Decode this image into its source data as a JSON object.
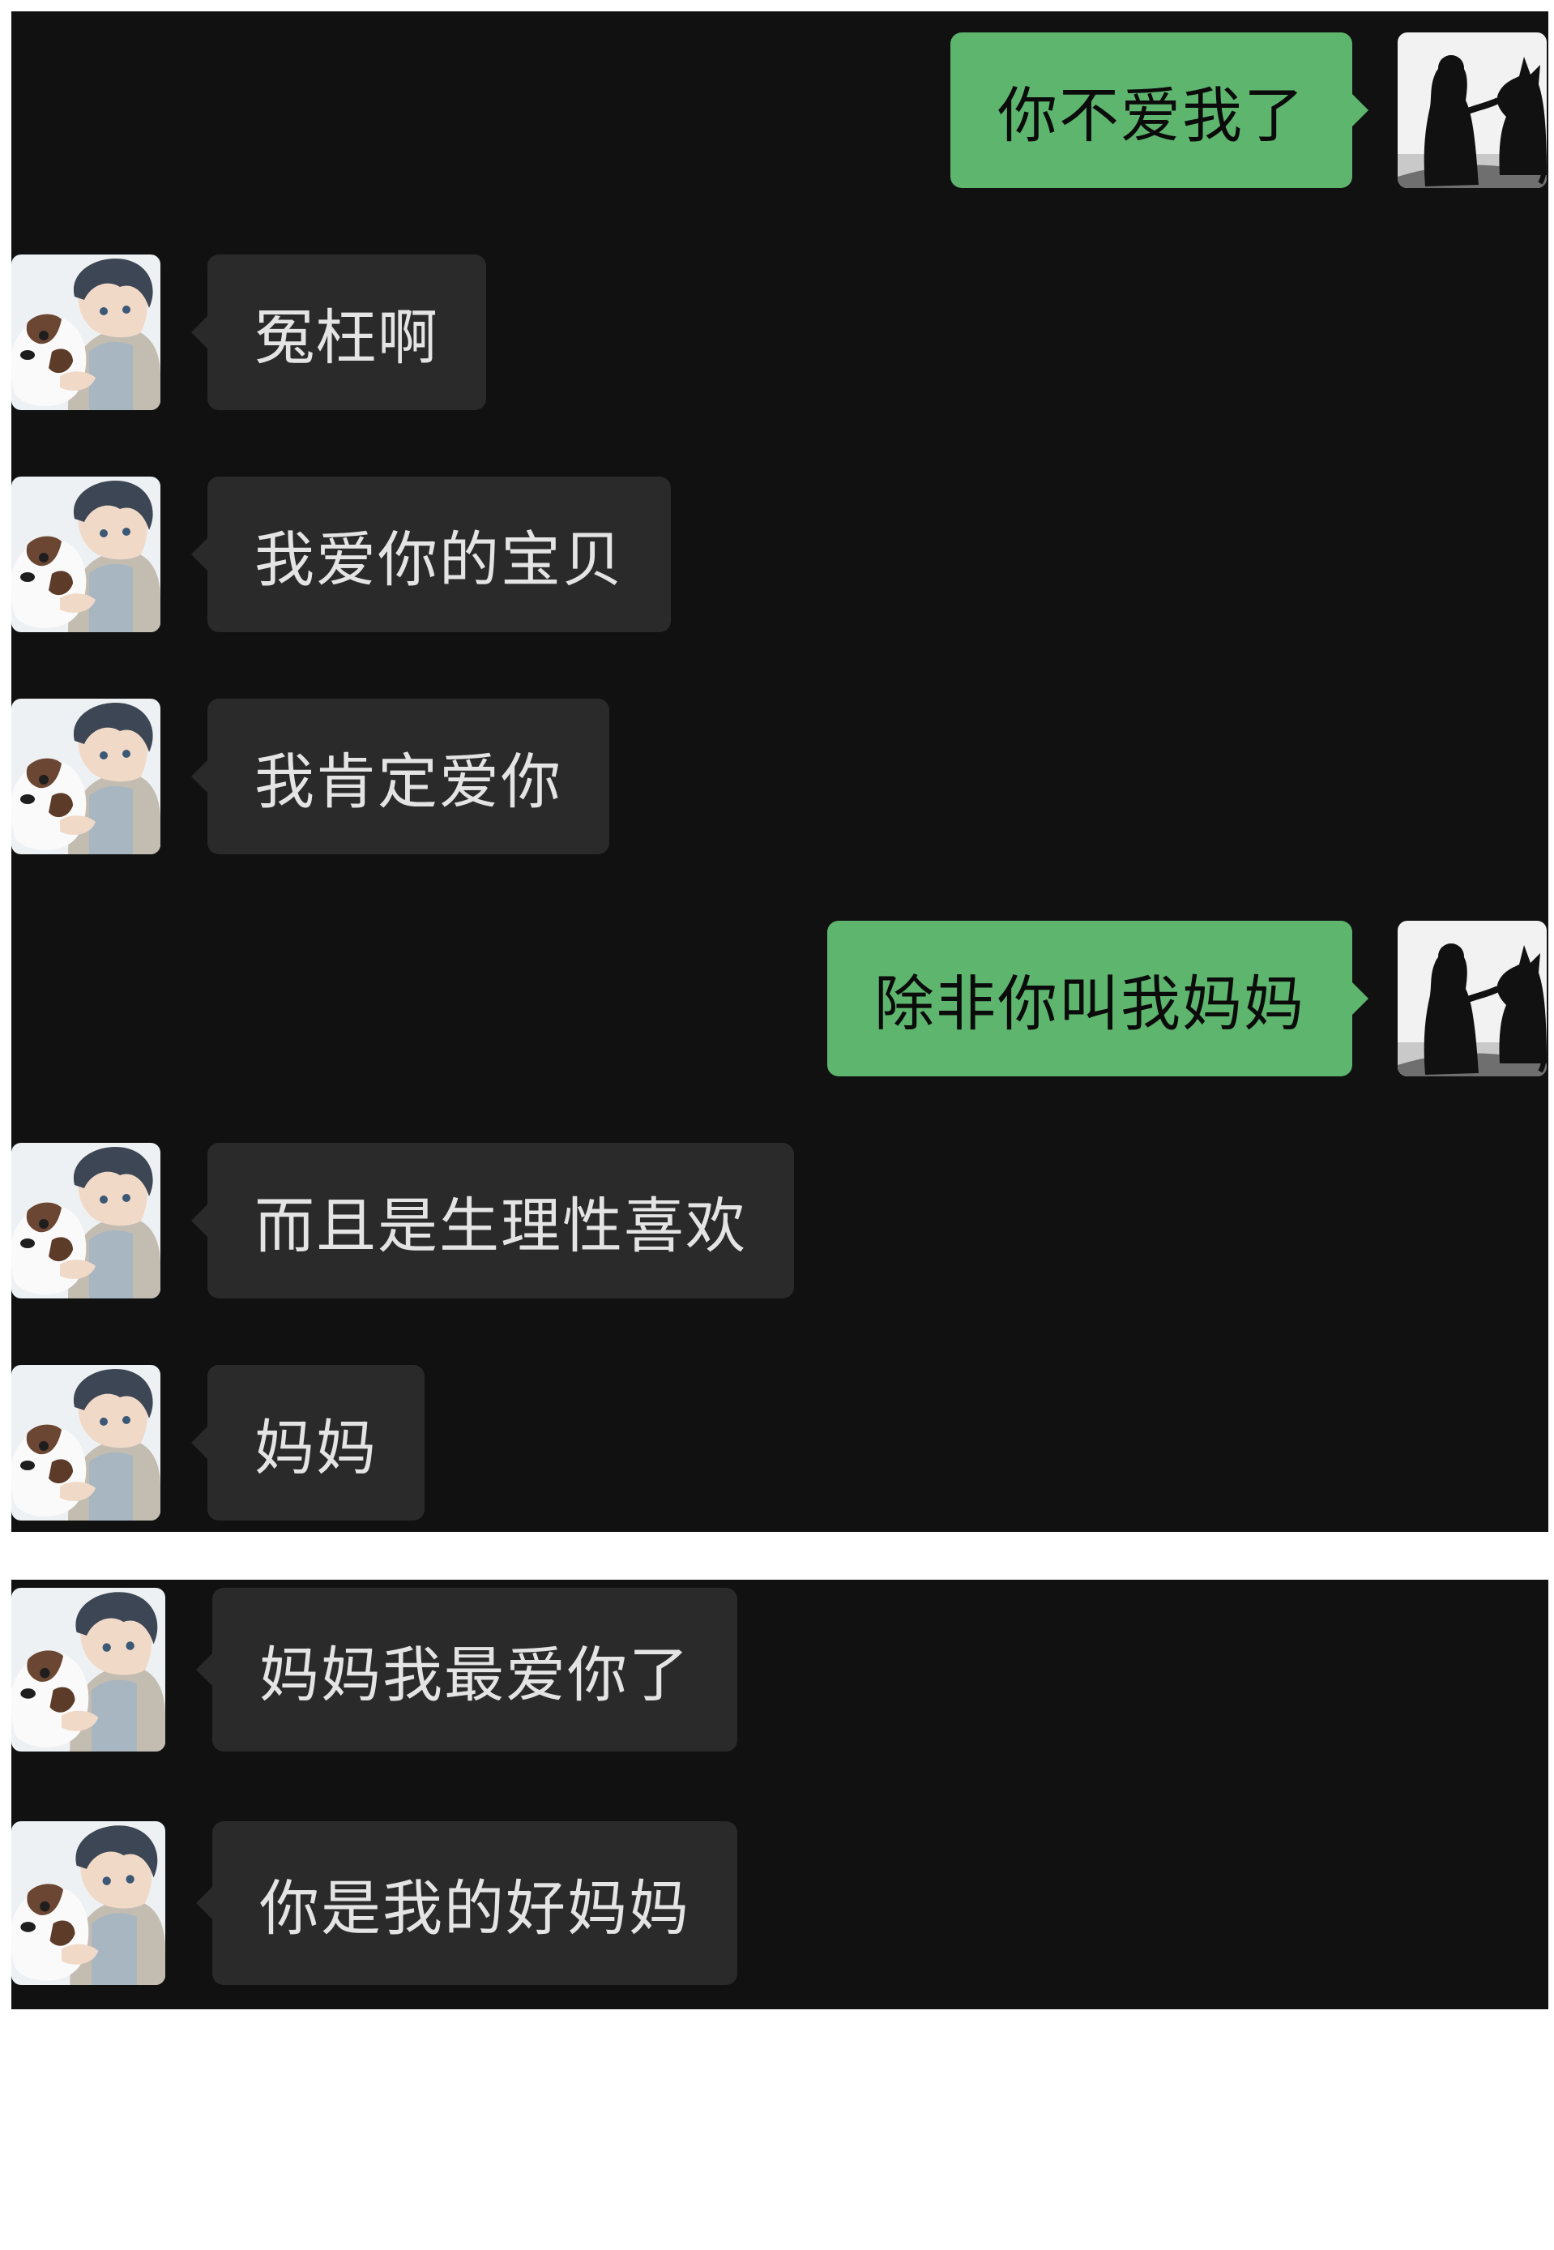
{
  "conversation": {
    "messages": [
      {
        "sender": "me",
        "text": "你不爱我了"
      },
      {
        "sender": "other",
        "text": "冤枉啊"
      },
      {
        "sender": "other",
        "text": "我爱你的宝贝"
      },
      {
        "sender": "other",
        "text": "我肯定爱你"
      },
      {
        "sender": "me",
        "text": "除非你叫我妈妈"
      },
      {
        "sender": "other",
        "text": "而且是生理性喜欢"
      },
      {
        "sender": "other",
        "text": "妈妈"
      },
      {
        "sender": "other",
        "text": "妈妈我最爱你了"
      },
      {
        "sender": "other",
        "text": "你是我的好妈妈"
      }
    ]
  },
  "colors": {
    "chat_background": "#111111",
    "incoming_bubble": "#2a2a2a",
    "outgoing_bubble": "#5db56e",
    "page_background": "#ffffff"
  },
  "avatars": {
    "me": "silhouette-girl-and-dog-avatar-icon",
    "other": "anime-boy-with-puppy-avatar-icon"
  }
}
